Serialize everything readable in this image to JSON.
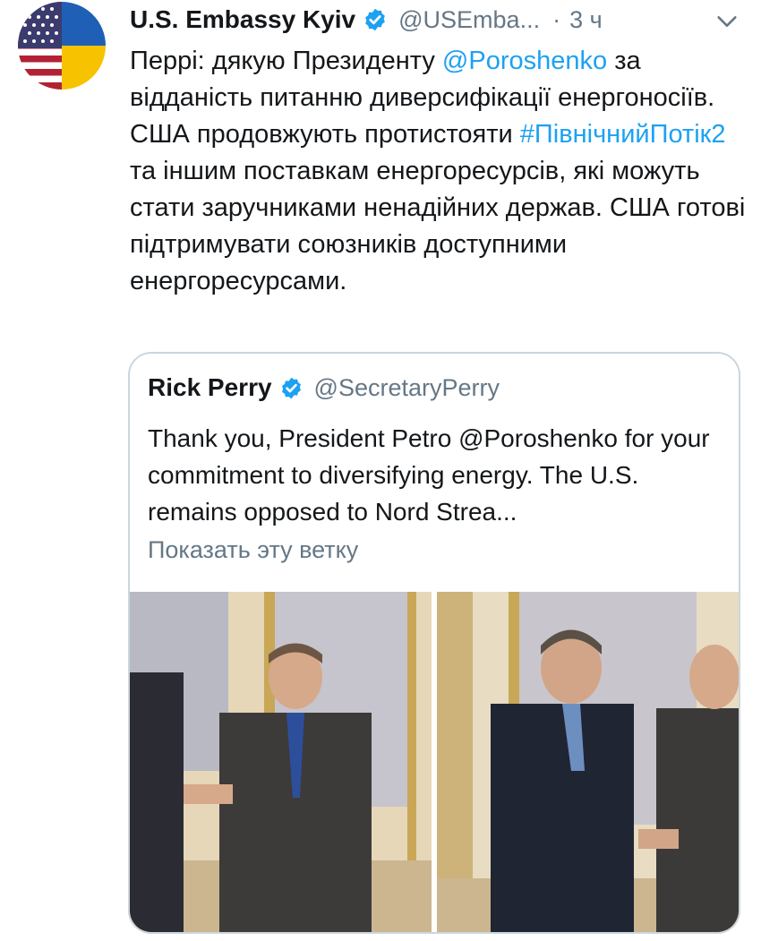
{
  "tweet": {
    "author_name": "U.S. Embassy Kyiv",
    "author_handle": "@USEmba...",
    "separator": "·",
    "time": "3 ч",
    "text": {
      "p1": "Перрі: дякую Президенту ",
      "mention": "@Poroshenko",
      "p2": " за відданість питанню диверсифікації енергоносіїв. США продовжують протистояти ",
      "hashtag": "#ПівнічнийПотік2",
      "p3": " та іншим поставкам енергоресурсів, які можуть стати заручниками ненадійних держав. США готові підтримувати союзників доступними енергоресурсами."
    }
  },
  "quoted": {
    "author_name": "Rick Perry",
    "author_handle": "@SecretaryPerry",
    "text": "Thank you, President Petro @Poroshenko for your commitment to diversifying energy. The U.S. remains opposed to Nord Strea...",
    "show_thread": "Показать эту ветку"
  },
  "icons": {
    "verified": "verified-badge-icon",
    "menu": "chevron-down-icon"
  },
  "colors": {
    "link": "#1da1f2",
    "verified": "#1da1f2",
    "muted": "#657786"
  }
}
